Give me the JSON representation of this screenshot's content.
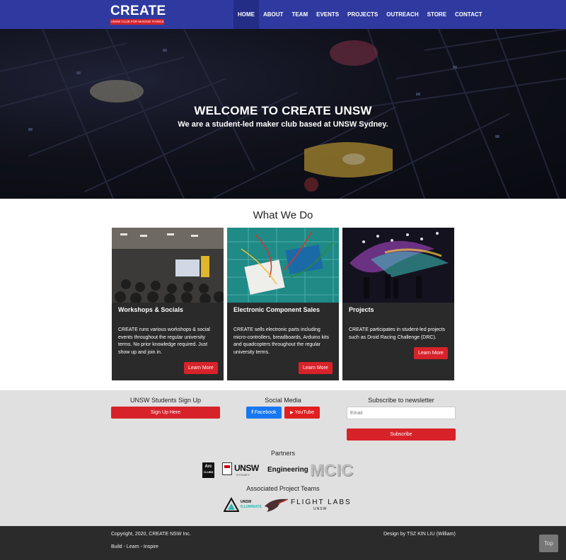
{
  "brand": {
    "logo_text": "CREATE",
    "logo_tagline": "UNSW CLUB FOR MAKING THINGS"
  },
  "nav": {
    "items": [
      {
        "label": "HOME",
        "active": true
      },
      {
        "label": "ABOUT",
        "active": false
      },
      {
        "label": "TEAM",
        "active": false
      },
      {
        "label": "EVENTS",
        "active": false
      },
      {
        "label": "PROJECTS",
        "active": false
      },
      {
        "label": "OUTREACH",
        "active": false
      },
      {
        "label": "STORE",
        "active": false
      },
      {
        "label": "CONTACT",
        "active": false
      }
    ]
  },
  "hero": {
    "title": "WELCOME TO CREATE UNSW",
    "subtitle": "We are a student-led maker club based at UNSW Sydney."
  },
  "what_we_do": {
    "title": "What We Do",
    "cards": [
      {
        "title": "Workshops & Socials",
        "text": "CREATE runs various workshops & social events throughout the regular university terms. No prior knowledge required. Just show up and join in.",
        "button": "Learn More"
      },
      {
        "title": "Electronic Component Sales",
        "text": "CREATE sells electronic parts including micro-controllers, breadboards, Arduino kits and quadcopters throughout the regular university terms.",
        "button": "Learn More"
      },
      {
        "title": "Projects",
        "text": "CREATE participates in student-led projects such as Droid Racing Challenge (DRC).",
        "button": "Learn More"
      }
    ]
  },
  "signup": {
    "heading": "UNSW Students Sign Up",
    "button": "Sign Up Here"
  },
  "social": {
    "heading": "Social Media",
    "facebook": "Facebook",
    "youtube": "YouTube",
    "facebook_icon_glyph": "f",
    "youtube_icon_glyph": "▶"
  },
  "newsletter": {
    "heading": "Subscribe to newsletter",
    "email_placeholder": "Email",
    "button": "Subscribe"
  },
  "partners": {
    "heading": "Partners",
    "arc_line1": "Arc",
    "arc_line2": "CLUBS",
    "unsw": "UNSW",
    "unsw_sub": "SYDNEY",
    "engineering": "Engineering",
    "mcic": "MCIC"
  },
  "project_teams": {
    "heading": "Associated Project Teams",
    "illuminate_line1": "UNSW",
    "illuminate_line2": "ILLUMINATE",
    "flight_labs": "FLIGHT LABS",
    "flight_labs_sub": "UNSW"
  },
  "footer": {
    "copyright": "Copyright, 2020, CREATE NSW Inc.",
    "tagline": "Build - Learn - Inspire",
    "design": "Design by TSZ KIN LIU (William)",
    "top_button": "Top"
  },
  "colors": {
    "nav_bg": "#2f3aa0",
    "accent_red": "#d8222a",
    "card_bg": "#2a2a2a",
    "band_bg": "#e0e0e0",
    "footer_bg": "#2b2b2b"
  }
}
